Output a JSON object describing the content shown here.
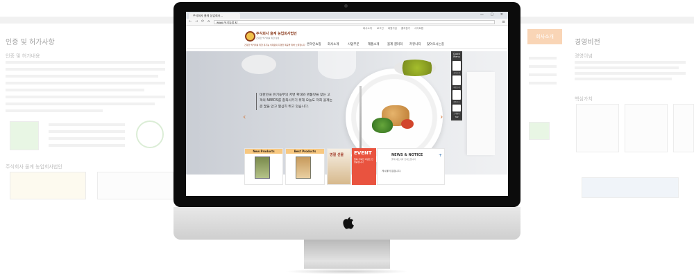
{
  "background_left": {
    "title": "인증 및 허가사항",
    "section1": "인증 및 허가내용",
    "section2": "주식회사 울계 농업회사법인"
  },
  "background_right": {
    "button": "회사소개",
    "title": "경영비전",
    "section1": "경영이념",
    "section2": "핵심가치"
  },
  "browser": {
    "tab_title": "주식회사 울계 농업회사...",
    "url": "www.우기농장.kr",
    "window_controls": "— ▢ ✕"
  },
  "site": {
    "util_links": [
      "회사소개",
      "로그인",
      "회원가입",
      "즐겨찾기",
      "사이트맵"
    ],
    "logo_name": "주식회사 울계 농업회사법인",
    "logo_sub": "건강한 먹거리를 위한 정성",
    "tagline": "건강한 먹거리를 위한 유기농 식재료의 다양한 제공을 위해 노력합니다",
    "gnb": [
      "온라인쇼핑",
      "회사소개",
      "사업부문",
      "제품소개",
      "울계 갤러리",
      "커뮤니티",
      "찾아오시는길"
    ]
  },
  "hero": {
    "text": "대한민국 유기농부의 저변 확대와 명품맛을 찾는 고객의 NEEDS를 충족시키기 위해 오늘도 저희 울계는 큰 꿈을 안고 열심히 뛰고 있습니다.",
    "prev": "‹",
    "next": "›",
    "dots": "● ● ● ●"
  },
  "quick_menu": {
    "title": "Quick Menu",
    "items": [
      "회사소개",
      "제품소개",
      "장바구니",
      "고객센터"
    ],
    "top": "TOP"
  },
  "cards": {
    "new_products": "New Products",
    "best_products": "Best Products",
    "promo": "명절 선물",
    "event": "EVENT",
    "event_sub": "행복 가득한 이벤트 진행중입니다",
    "news_title": "NEWS & NOTICE",
    "news_sub": "울계 새소식과 안내드립니다",
    "news_item": "게시물이 없습니다.",
    "news_more": "+"
  },
  "colors": {
    "accent": "#f8c880",
    "brand": "#8b3b1d",
    "event": "#e9533f",
    "arrow": "#d2763a"
  }
}
